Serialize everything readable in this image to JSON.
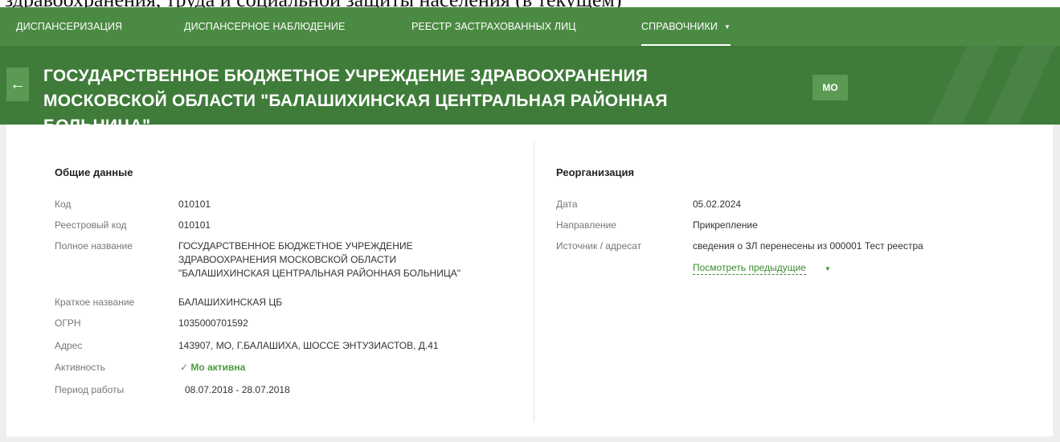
{
  "top_text": "здравоохранения, труда и социальной защиты населения (в текущем)",
  "nav": {
    "items": [
      {
        "label": "ДИСПАНСЕРИЗАЦИЯ"
      },
      {
        "label": "ДИСПАНСЕРНОЕ НАБЛЮДЕНИЕ"
      },
      {
        "label": "РЕЕСТР ЗАСТРАХОВАННЫХ ЛИЦ"
      },
      {
        "label": "СПРАВОЧНИКИ"
      }
    ],
    "active_caret": "▼"
  },
  "header": {
    "back_icon": "←",
    "title": "ГОСУДАРСТВЕННОЕ БЮДЖЕТНОЕ УЧРЕЖДЕНИЕ ЗДРАВООХРАНЕНИЯ МОСКОВСКОЙ ОБЛАСТИ \"БАЛАШИХИНСКАЯ ЦЕНТРАЛЬНАЯ РАЙОННАЯ БОЛЬНИЦА\"",
    "badge": "МО"
  },
  "general": {
    "title": "Общие данные",
    "fields": [
      {
        "label": "Код",
        "value": "010101"
      },
      {
        "label": "Реестровый код",
        "value": "010101"
      },
      {
        "label": "Полное название",
        "value_lines": [
          "ГОСУДАРСТВЕННОЕ БЮДЖЕТНОЕ УЧРЕЖДЕНИЕ",
          "ЗДРАВООХРАНЕНИЯ МОСКОВСКОЙ ОБЛАСТИ",
          "\"БАЛАШИХИНСКАЯ ЦЕНТРАЛЬНАЯ РАЙОННАЯ БОЛЬНИЦА\""
        ]
      },
      {
        "label": "Краткое название",
        "value": "БАЛАШИХИНСКАЯ ЦБ"
      },
      {
        "label": "ОГРН",
        "value": "1035000701592"
      },
      {
        "label": "Адрес",
        "value": "143907, МО, Г.БАЛАШИХА, ШОССЕ ЭНТУЗИАСТОВ, Д.41"
      },
      {
        "label": "Активность",
        "value": "Мо активна",
        "icon": "✓"
      },
      {
        "label": "Период работы",
        "value": "08.07.2018 - 28.07.2018"
      }
    ]
  },
  "reorg": {
    "title": "Реорганизация",
    "fields": [
      {
        "label": "Дата",
        "value": "05.02.2024"
      },
      {
        "label": "Направление",
        "value": "Прикрепление"
      },
      {
        "label": "Источник / адресат",
        "value": "сведения о ЗЛ перенесены из 000001 Тест реестра"
      }
    ],
    "link": "Посмотреть предыдущие",
    "link_caret": "▼"
  },
  "colors": {
    "nav": "#4b8a43",
    "header": "#3f7c3a",
    "accent": "#4b9a3f"
  }
}
